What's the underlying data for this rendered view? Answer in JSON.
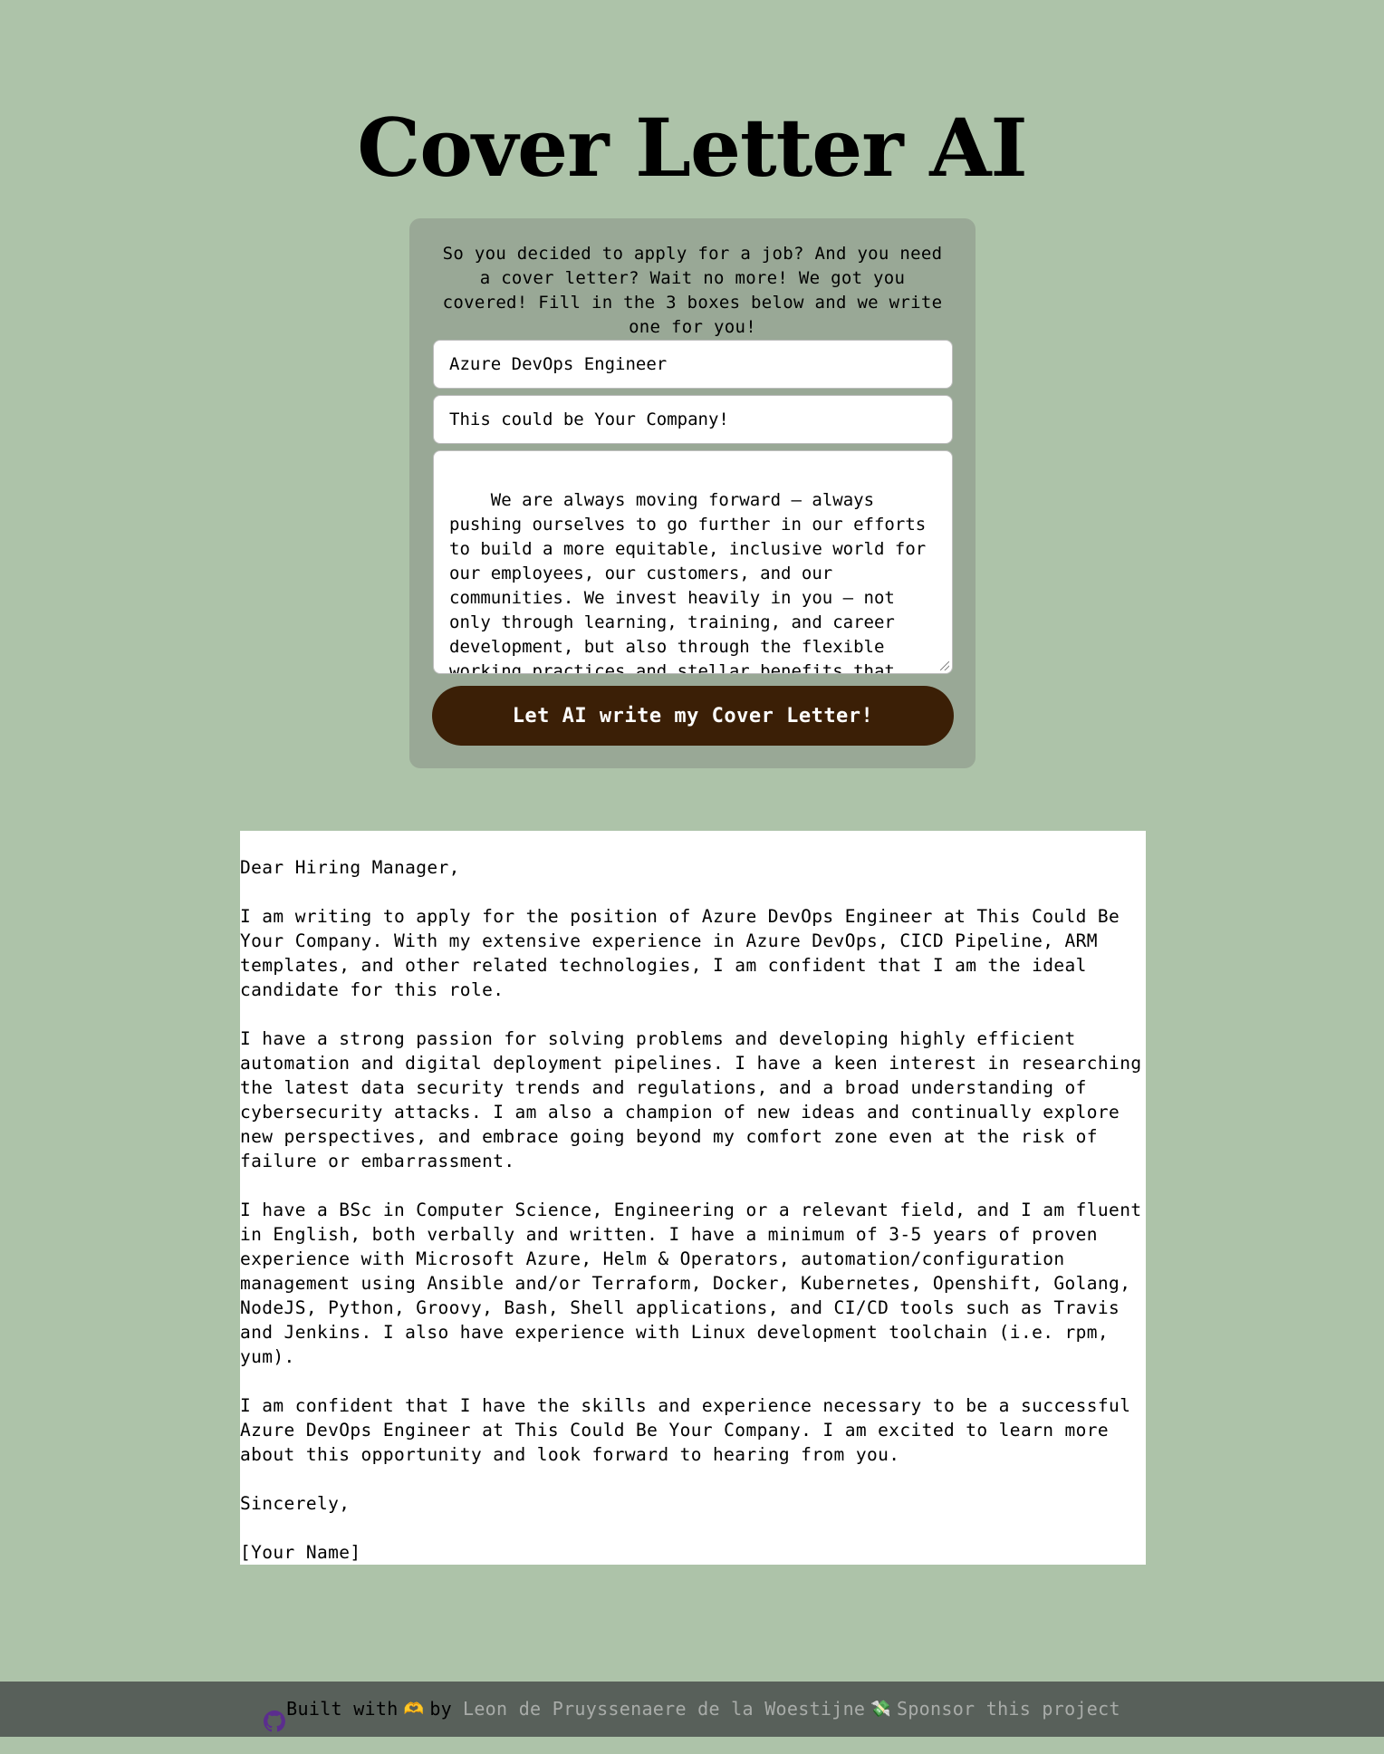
{
  "page": {
    "title": "Cover Letter AI"
  },
  "form": {
    "intro": "So you decided to apply for a job? And you need a cover letter? Wait no more! We got you covered! Fill in the 3 boxes below and we write one for you!",
    "job_title_value": "Azure DevOps Engineer",
    "company_value": "This could be Your Company!",
    "description_value": "We are always moving forward – always pushing ourselves to go further in our efforts to build a more equitable, inclusive world for our employees, our customers, and our communities. We invest heavily in you – not only through learning, training, and career development, but also through the flexible working practices and stellar benefits that help you grow and progress",
    "submit_label": "Let AI write my Cover Letter!"
  },
  "letter": {
    "greeting": "Dear Hiring Manager,",
    "paragraphs": [
      "I am writing to apply for the position of Azure DevOps Engineer at This Could Be Your Company. With my extensive experience in Azure DevOps, CICD Pipeline, ARM templates, and other related technologies, I am confident that I am the ideal candidate for this role.",
      "I have a strong passion for solving problems and developing highly efficient automation and digital deployment pipelines. I have a keen interest in researching the latest data security trends and regulations, and a broad understanding of cybersecurity attacks. I am also a champion of new ideas and continually explore new perspectives, and embrace going beyond my comfort zone even at the risk of failure or embarrassment.",
      "I have a BSc in Computer Science, Engineering or a relevant field, and I am fluent in English, both verbally and written. I have a minimum of 3-5 years of proven experience with Microsoft Azure, Helm & Operators, automation/configuration management using Ansible and/or Terraform, Docker, Kubernetes, Openshift, Golang, NodeJS, Python, Groovy, Bash, Shell applications, and CI/CD tools such as Travis and Jenkins. I also have experience with Linux development toolchain (i.e. rpm, yum).",
      "I am confident that I have the skills and experience necessary to be a successful Azure DevOps Engineer at This Could Be Your Company. I am excited to learn more about this opportunity and look forward to hearing from you."
    ],
    "closing": "Sincerely,",
    "signature": "[Your Name]"
  },
  "footer": {
    "github_icon": "github-icon",
    "built_with": "Built with",
    "heart_glyph": "🫶",
    "by": "by",
    "author": "Leon de Pruyssenaere de la Woestijne",
    "money_glyph": "💸",
    "sponsor": "Sponsor this project"
  },
  "colors": {
    "background": "#adc3a9",
    "card": "#99a896",
    "button": "#3b1f06",
    "footer": "#58605a",
    "link": "#a9aca9"
  }
}
